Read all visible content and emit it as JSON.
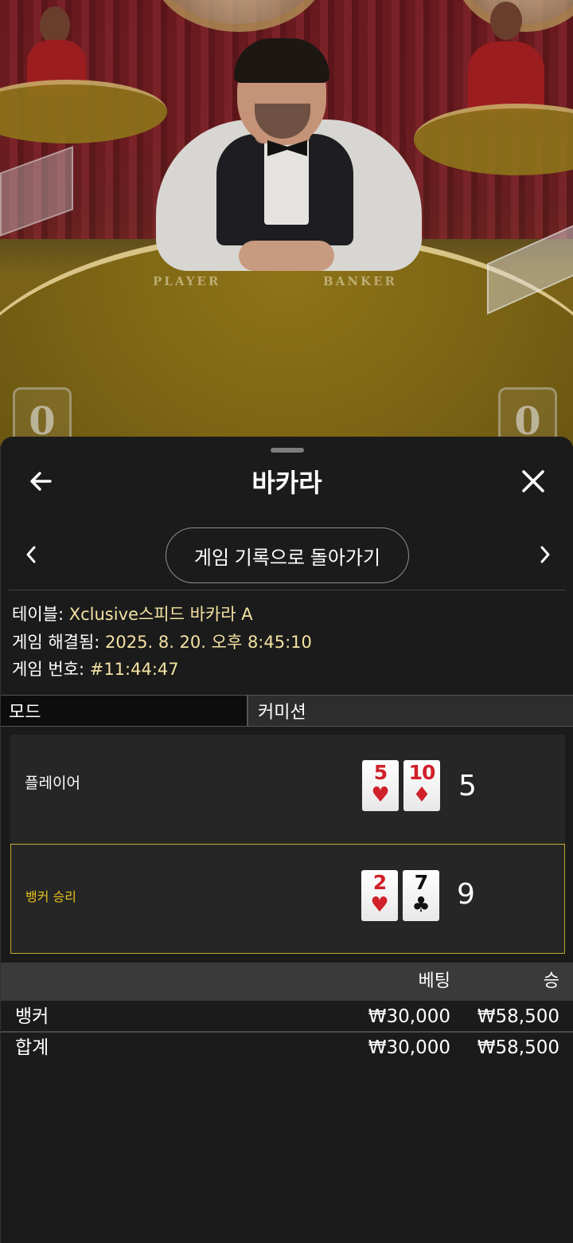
{
  "video": {
    "table_labels": {
      "player": "PLAYER",
      "banker": "BANKER"
    },
    "player_score": "0",
    "banker_score": "0"
  },
  "header": {
    "title": "바카라",
    "back_icon": "arrow-left-icon",
    "close_icon": "close-icon"
  },
  "history_nav": {
    "prev_icon": "chevron-left-icon",
    "next_icon": "chevron-right-icon",
    "back_label": "게임 기록으로 돌아가기"
  },
  "details": {
    "table_key": "테이블:",
    "table_value": "Xclusive스피드 바카라 A",
    "resolved_key": "게임 해결됨:",
    "resolved_value": "2025. 8. 20. 오후 8:45:10",
    "number_key": "게임 번호:",
    "number_value": "#11:44:47"
  },
  "tabs": {
    "mode": "모드",
    "commission": "커미션"
  },
  "hands": {
    "player": {
      "label": "플레이어",
      "cards": [
        {
          "rank": "5",
          "suit": "♥"
        },
        {
          "rank": "10",
          "suit": "♦"
        }
      ],
      "total": "5"
    },
    "banker": {
      "label": "뱅커 승리",
      "cards": [
        {
          "rank": "2",
          "suit": "♥"
        },
        {
          "rank": "7",
          "suit": "♣"
        }
      ],
      "total": "9"
    }
  },
  "bets": {
    "headers": {
      "bet": "베팅",
      "win": "승"
    },
    "rows": [
      {
        "name": "뱅커",
        "bet": "₩30,000",
        "win": "₩58,500"
      }
    ],
    "total": {
      "name": "합계",
      "bet": "₩30,000",
      "win": "₩58,500"
    }
  },
  "colors": {
    "accent_gold": "#c2a92c",
    "value_text": "#f3e2a2",
    "winner_label": "#e6c21a",
    "card_red": "#d0202a"
  }
}
